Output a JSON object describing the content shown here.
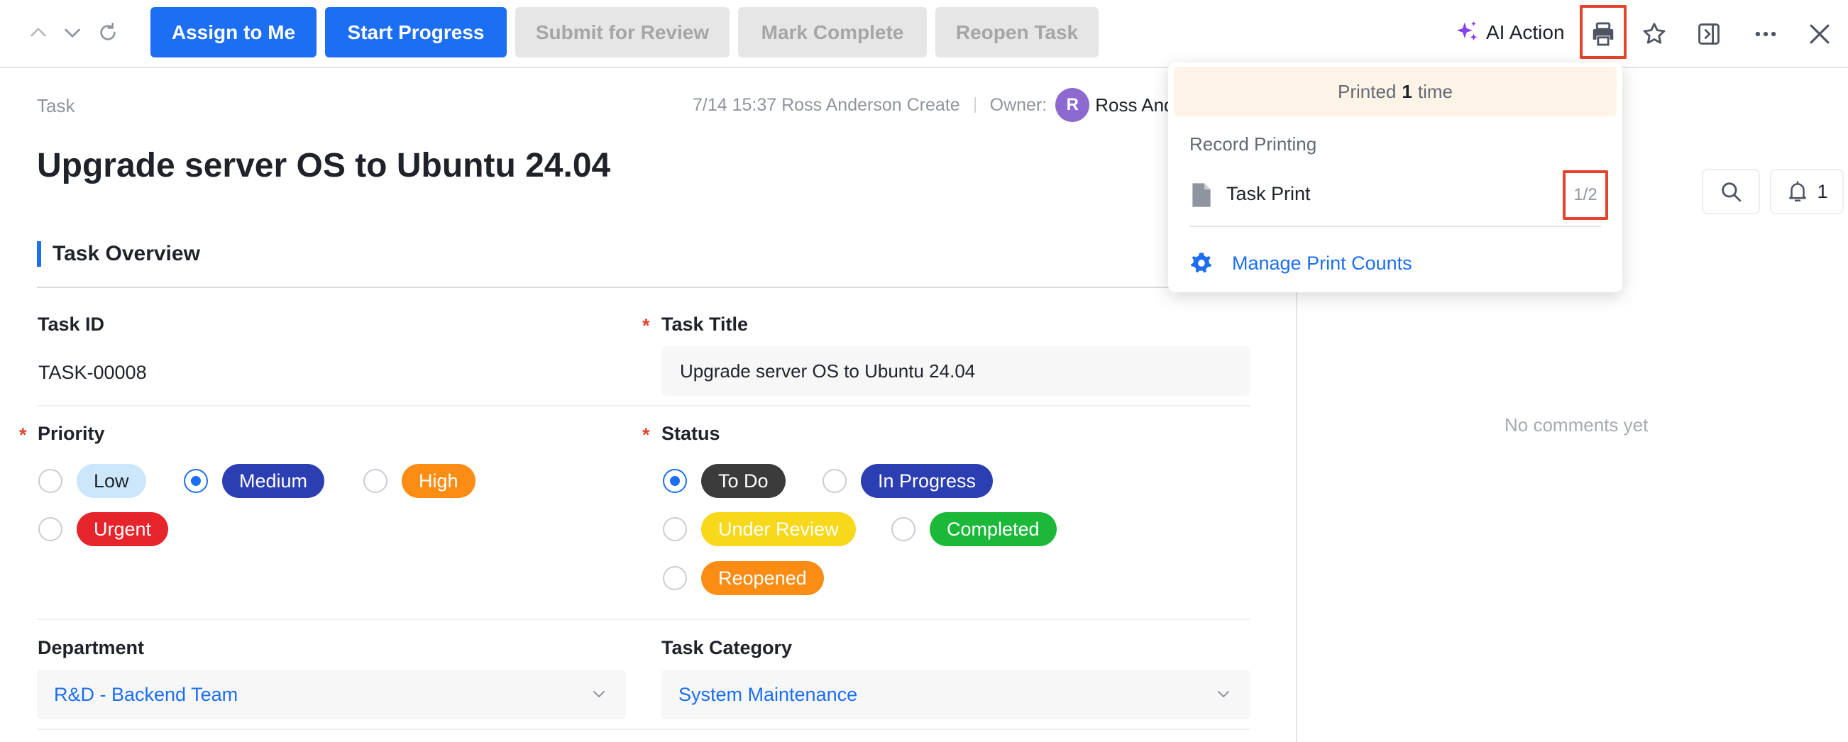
{
  "toolbar": {
    "buttons": {
      "assign": "Assign to Me",
      "start": "Start Progress",
      "submit": "Submit for Review",
      "complete": "Mark Complete",
      "reopen": "Reopen Task"
    },
    "ai_action": "AI Action"
  },
  "page": {
    "breadcrumb": "Task",
    "meta_created": "7/14 15:37 Ross Anderson Create",
    "owner_label": "Owner:",
    "owner_initial": "R",
    "owner_name": "Ross Anderson",
    "title": "Upgrade server OS to Ubuntu 24.04",
    "section": "Task Overview"
  },
  "fields": {
    "task_id_label": "Task ID",
    "task_id_value": "TASK-00008",
    "task_title_label": "Task Title",
    "task_title_value": "Upgrade server OS to Ubuntu 24.04",
    "priority_label": "Priority",
    "priority_options": [
      {
        "label": "Low",
        "selected": false,
        "bg": "#cce7fb",
        "color": "#1f2329"
      },
      {
        "label": "Medium",
        "selected": true,
        "bg": "#2b3fb3",
        "color": "#ffffff"
      },
      {
        "label": "High",
        "selected": false,
        "bg": "#fb8c14",
        "color": "#ffffff"
      },
      {
        "label": "Urgent",
        "selected": false,
        "bg": "#e6242b",
        "color": "#ffffff"
      }
    ],
    "status_label": "Status",
    "status_options": [
      {
        "label": "To Do",
        "selected": true,
        "bg": "#3b3b3b",
        "color": "#ffffff"
      },
      {
        "label": "In Progress",
        "selected": false,
        "bg": "#2b3fb3",
        "color": "#ffffff"
      },
      {
        "label": "Under Review",
        "selected": false,
        "bg": "#f7d81a",
        "color": "#ffffff"
      },
      {
        "label": "Completed",
        "selected": false,
        "bg": "#1cb83a",
        "color": "#ffffff"
      },
      {
        "label": "Reopened",
        "selected": false,
        "bg": "#fb8c14",
        "color": "#ffffff"
      }
    ],
    "department_label": "Department",
    "department_value": "R&D - Backend Team",
    "category_label": "Task Category",
    "category_value": "System Maintenance"
  },
  "right_panel": {
    "reminder_count": "1",
    "no_comments": "No comments yet"
  },
  "print_popover": {
    "banner_prefix": "Printed",
    "banner_count": "1",
    "banner_suffix": "time",
    "subtitle": "Record Printing",
    "item_label": "Task Print",
    "item_count": "1/2",
    "manage": "Manage Print Counts"
  },
  "colors": {
    "primary": "#1c6ef2",
    "highlight": "#e5432d"
  }
}
